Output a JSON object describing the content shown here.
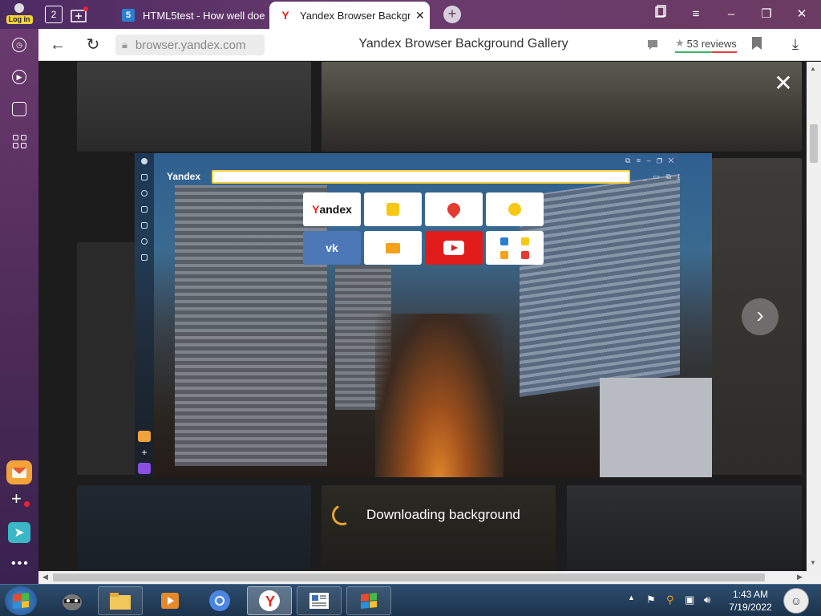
{
  "browser": {
    "login_label": "Log in",
    "tabs_count_badge": "2",
    "tabs": [
      {
        "title": "HTML5test - How well doe",
        "favicon": "html5-icon",
        "active": false
      },
      {
        "title": "Yandex Browser Backgro",
        "favicon": "yandex-y-icon",
        "active": true
      }
    ],
    "new_tab_label": "+"
  },
  "address_bar": {
    "url": "browser.yandex.com",
    "page_title": "Yandex Browser Background Gallery",
    "reviews": "53 reviews",
    "review_star": "★"
  },
  "gallery": {
    "close_glyph": "✕",
    "next_glyph": "›",
    "downloading_text": "Downloading background",
    "preview": {
      "logo": "Yandex",
      "tiles": [
        {
          "kind": "yandex",
          "label_y": "Y",
          "label_rest": "andex"
        },
        {
          "kind": "taxi",
          "icon": "taxi-icon"
        },
        {
          "kind": "maps",
          "icon": "map-pin-icon"
        },
        {
          "kind": "music",
          "icon": "play-icon"
        },
        {
          "kind": "vk",
          "label": "vk"
        },
        {
          "kind": "mail",
          "icon": "mail-icon"
        },
        {
          "kind": "youtube",
          "icon": "youtube-icon"
        },
        {
          "kind": "multi",
          "icon": "apps-icon"
        }
      ]
    }
  },
  "sidebar": {
    "items": [
      "history-icon",
      "media-icon",
      "screenshot-icon",
      "apps-grid-icon",
      "mail-app-icon",
      "add-app-icon",
      "messenger-app-icon",
      "more-icon"
    ]
  },
  "taskbar": {
    "clock_time": "1:43 AM",
    "clock_date": "7/19/2022",
    "apps": [
      "raccoon-icon",
      "file-explorer-icon",
      "video-player-icon",
      "chromium-icon",
      "yandex-browser-icon",
      "news-icon",
      "windows-flag-icon"
    ]
  },
  "colors": {
    "tab_strip": "#5a3468",
    "accent_yellow": "#f5d03c",
    "spinner": "#e9a52a",
    "youtube_red": "#e21b1b",
    "vk_blue": "#4c78b8"
  }
}
